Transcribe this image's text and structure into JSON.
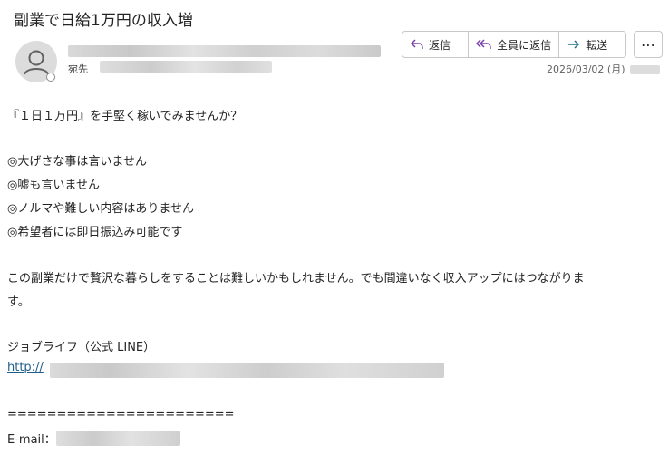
{
  "email": {
    "subject": "副業で日給1万円の収入増",
    "to_label": "宛先",
    "date": "2026/03/02 (月)",
    "actions": {
      "reply": "返信",
      "reply_all": "全員に返信",
      "forward": "転送",
      "more": "⋯"
    },
    "body": {
      "line1": "『１日１万円』を手堅く稼いでみませんか？",
      "bullets": [
        "◎大げさな事は言いません",
        "◎嘘も言いません",
        "◎ノルマや難しい内容はありません",
        "◎希望者には即日振込み可能です"
      ],
      "paragraph": "この副業だけで贅沢な暮らしをすることは難しいかもしれません。でも間違いなく収入アップにはつながりま",
      "paragraph_cont": "す。",
      "signature": "ジョブライフ（公式 LINE）",
      "link_prefix": "http://",
      "divider": "=======================",
      "email_label": "E-mail："
    }
  }
}
